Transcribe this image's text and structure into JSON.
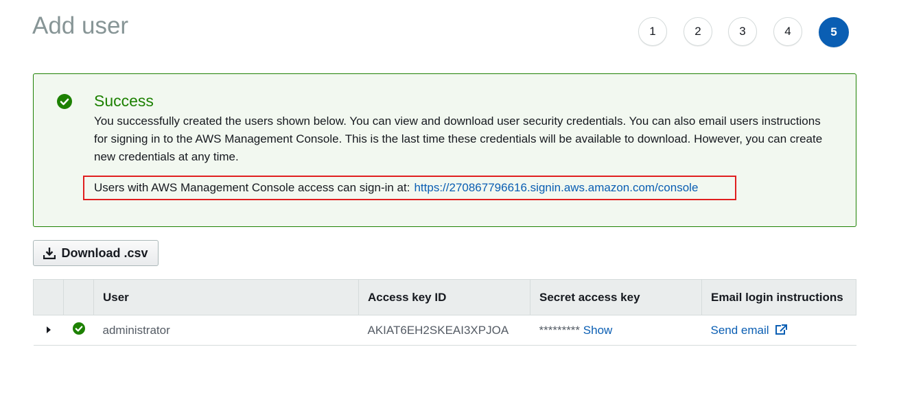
{
  "page": {
    "title": "Add user"
  },
  "steps": [
    {
      "label": "1",
      "active": false
    },
    {
      "label": "2",
      "active": false
    },
    {
      "label": "3",
      "active": false
    },
    {
      "label": "4",
      "active": false
    },
    {
      "label": "5",
      "active": true
    }
  ],
  "alert": {
    "icon": "success-check-icon",
    "title": "Success",
    "message": "You successfully created the users shown below. You can view and download user security credentials. You can also email users instructions for signing in to the AWS Management Console. This is the last time these credentials will be available to download. However, you can create new credentials at any time.",
    "signin_label": "Users with AWS Management Console access can sign-in at:",
    "signin_url": "https://270867796616.signin.aws.amazon.com/console"
  },
  "download_button": {
    "label": "Download .csv",
    "icon": "download-icon"
  },
  "table": {
    "headers": {
      "user": "User",
      "access_key_id": "Access key ID",
      "secret_access_key": "Secret access key",
      "email_login": "Email login instructions"
    },
    "rows": [
      {
        "user": "administrator",
        "access_key_id": "AKIAT6EH2SKEAI3XPJOA",
        "secret_masked": "*********",
        "secret_show": "Show",
        "email_action": "Send email"
      }
    ]
  },
  "colors": {
    "success": "#1d8102",
    "link": "#0a5eb3",
    "highlight": "#e01e1e",
    "active_step": "#0a5eb3"
  }
}
